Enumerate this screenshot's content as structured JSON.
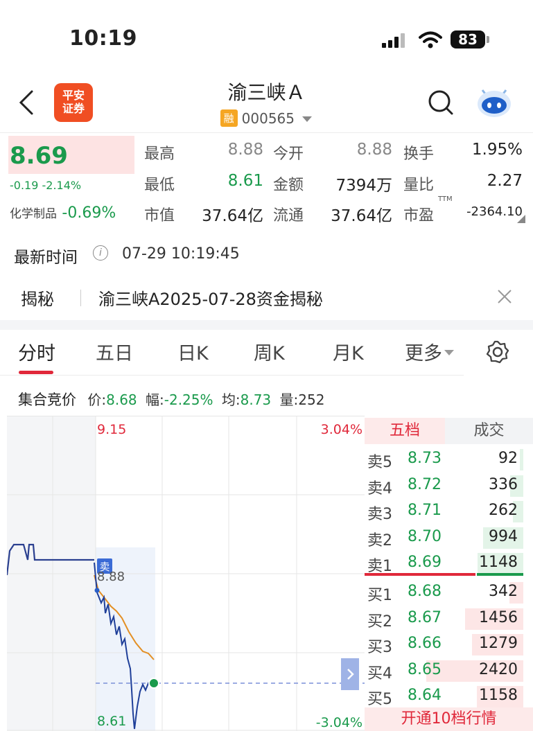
{
  "status_bar": {
    "time": "10:19",
    "battery": "83"
  },
  "header": {
    "title": "渝三峡Ａ",
    "code": "000565",
    "badge": "融",
    "logo_text_1": "平安",
    "logo_text_2": "证券"
  },
  "quote": {
    "price": "8.69",
    "change": "-0.19  -2.14%",
    "industry_label": "化学制品",
    "industry_change": "-0.69%",
    "rows": [
      [
        {
          "label": "最高",
          "value": "8.88",
          "color": "gray"
        },
        {
          "label": "今开",
          "value": "8.88",
          "color": "gray"
        },
        {
          "label": "换手",
          "value": "1.95%",
          "color": "black"
        }
      ],
      [
        {
          "label": "最低",
          "value": "8.61",
          "color": "green"
        },
        {
          "label": "金额",
          "value": "7394万",
          "color": "black"
        },
        {
          "label": "量比",
          "value": "2.27",
          "color": "black"
        }
      ],
      [
        {
          "label": "市值",
          "value": "37.64亿",
          "color": "black"
        },
        {
          "label": "流通",
          "value": "37.64亿",
          "color": "black"
        },
        {
          "label": "市盈",
          "value": "-2364.10",
          "color": "black"
        }
      ]
    ],
    "ttm": "TTM"
  },
  "update": {
    "label": "最新时间",
    "value": "07-29 10:19:45"
  },
  "reveal": {
    "label": "揭秘",
    "text": "渝三峡A2025-07-28资金揭秘"
  },
  "tabs": [
    "分时",
    "五日",
    "日K",
    "周K",
    "月K",
    "更多"
  ],
  "auction": {
    "label": "集合竞价",
    "price_label": "价:",
    "price": "8.68",
    "amp_label": "幅:",
    "amp": "-2.25%",
    "avg_label": "均:",
    "avg": "8.73",
    "vol_label": "量:",
    "vol": "252"
  },
  "chart": {
    "top_price": "9.15",
    "bottom_price": "8.61",
    "top_pct": "3.04%",
    "bottom_pct": "-3.04%",
    "mid_price": "8.88",
    "sell_marker": "卖"
  },
  "orderbook": {
    "tab_five": "五档",
    "tab_deal": "成交",
    "sells": [
      {
        "label": "卖5",
        "price": "8.73",
        "vol": "92"
      },
      {
        "label": "卖4",
        "price": "8.72",
        "vol": "336"
      },
      {
        "label": "卖3",
        "price": "8.71",
        "vol": "262"
      },
      {
        "label": "卖2",
        "price": "8.70",
        "vol": "994"
      },
      {
        "label": "卖1",
        "price": "8.69",
        "vol": "1148"
      }
    ],
    "buys": [
      {
        "label": "买1",
        "price": "8.68",
        "vol": "342"
      },
      {
        "label": "买2",
        "price": "8.67",
        "vol": "1456"
      },
      {
        "label": "买3",
        "price": "8.66",
        "vol": "1279"
      },
      {
        "label": "买4",
        "price": "8.65",
        "vol": "2420"
      },
      {
        "label": "买5",
        "price": "8.64",
        "vol": "1158"
      }
    ],
    "footer": "开通10档行情"
  }
}
